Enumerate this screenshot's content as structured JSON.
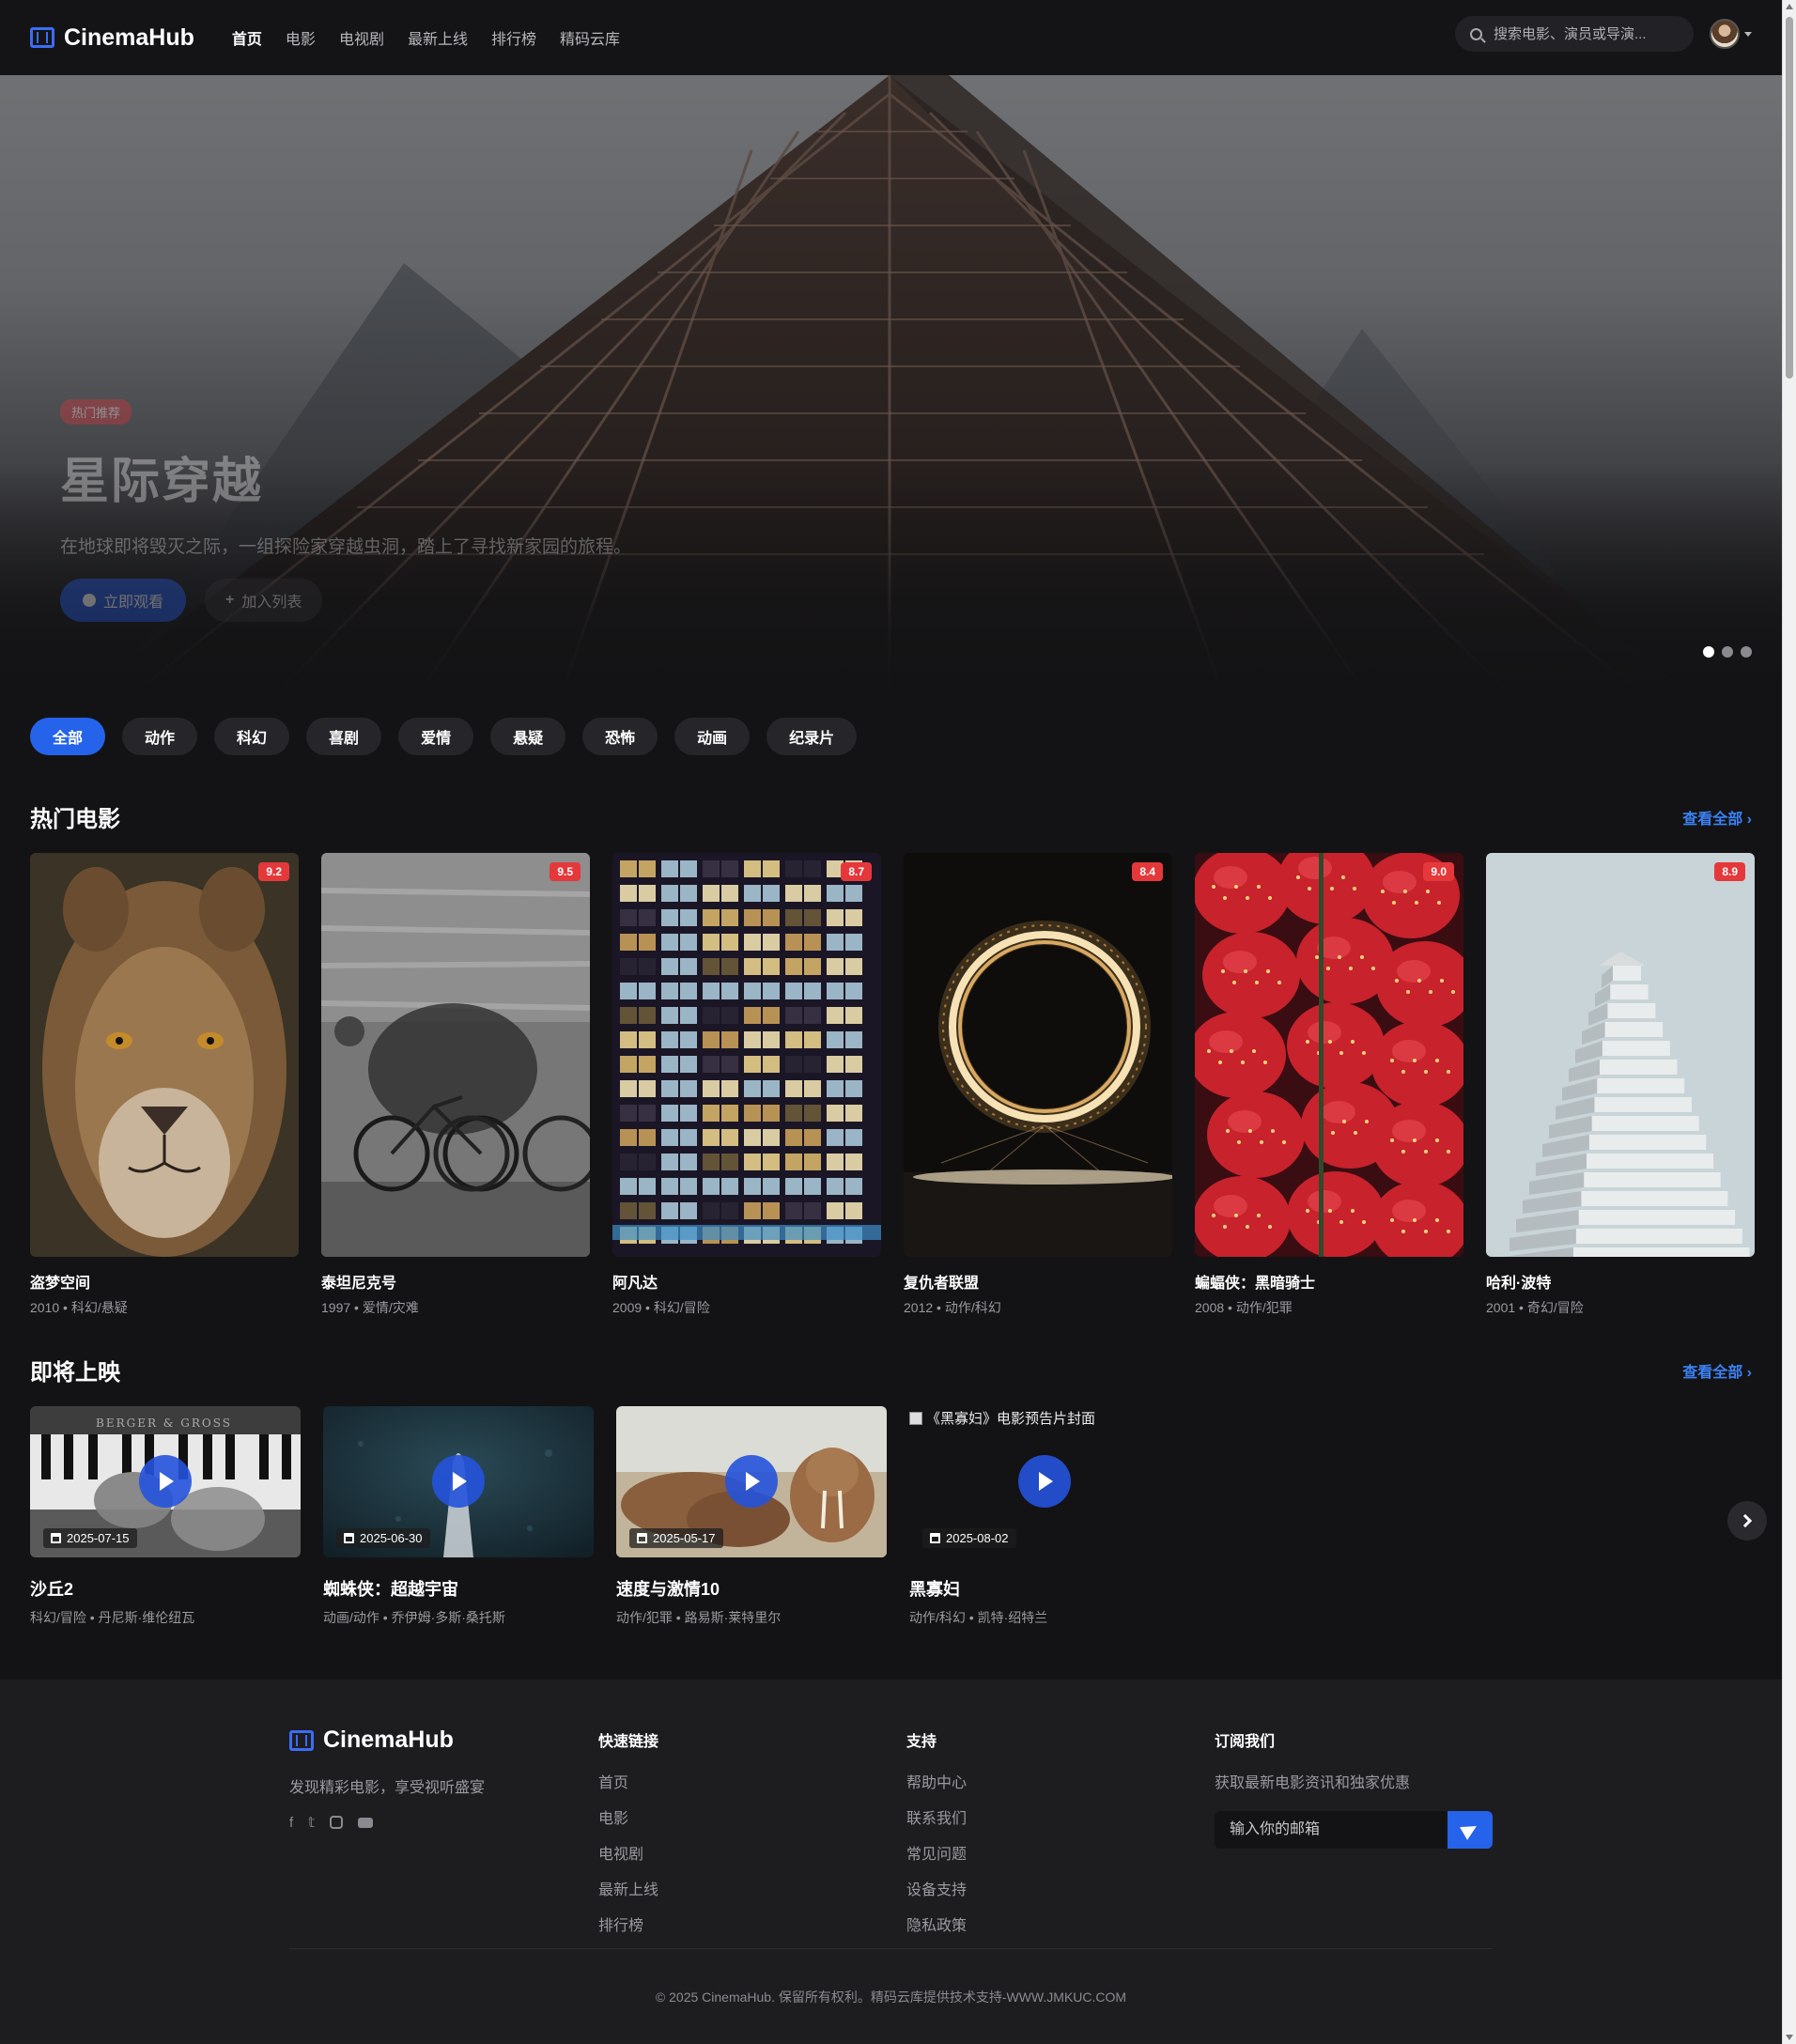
{
  "header": {
    "brand": "CinemaHub",
    "nav": [
      "首页",
      "电影",
      "电视剧",
      "最新上线",
      "排行榜",
      "精码云库"
    ],
    "active_nav": "首页",
    "search_placeholder": "搜索电影、演员或导演..."
  },
  "hero": {
    "badge": "热门推荐",
    "title": "星际穿越",
    "description": "在地球即将毁灭之际，一组探险家穿越虫洞，踏上了寻找新家园的旅程。",
    "watch_label": "立即观看",
    "list_label": "加入列表",
    "slides_total": 3,
    "active_slide": 1
  },
  "genres": {
    "items": [
      "全部",
      "动作",
      "科幻",
      "喜剧",
      "爱情",
      "悬疑",
      "恐怖",
      "动画",
      "纪录片"
    ],
    "active": "全部"
  },
  "popular": {
    "title": "热门电影",
    "view_all": "查看全部",
    "movies": [
      {
        "title": "盗梦空间",
        "year": "2010",
        "genre": "科幻/悬疑",
        "rating": "9.2",
        "meta": "2010 • 科幻/悬疑",
        "image": "lioness"
      },
      {
        "title": "泰坦尼克号",
        "year": "1997",
        "genre": "爱情/灾难",
        "rating": "9.5",
        "meta": "1997 • 爱情/灾难",
        "image": "cyclists"
      },
      {
        "title": "阿凡达",
        "year": "2009",
        "genre": "科幻/冒险",
        "rating": "8.7",
        "meta": "2009 • 科幻/冒险",
        "image": "building-windows"
      },
      {
        "title": "复仇者联盟",
        "year": "2012",
        "genre": "动作/科幻",
        "rating": "8.4",
        "meta": "2012 • 动作/科幻",
        "image": "fire-ring"
      },
      {
        "title": "蝙蝠侠：黑暗骑士",
        "year": "2008",
        "genre": "动作/犯罪",
        "rating": "9.0",
        "meta": "2008 • 动作/犯罪",
        "image": "strawberries"
      },
      {
        "title": "哈利·波特",
        "year": "2001",
        "genre": "奇幻/冒险",
        "rating": "8.9",
        "meta": "2001 • 奇幻/冒险",
        "image": "white-tower"
      }
    ]
  },
  "upcoming": {
    "title": "即将上映",
    "view_all": "查看全部",
    "movies": [
      {
        "title": "沙丘2",
        "date": "2025-07-15",
        "meta": "科幻/冒险 • 丹尼斯·维伦纽瓦",
        "image": "piano"
      },
      {
        "title": "蜘蛛侠：超越宇宙",
        "date": "2025-06-30",
        "meta": "动画/动作 • 乔伊姆·多斯·桑托斯",
        "image": "underwater"
      },
      {
        "title": "速度与激情10",
        "date": "2025-05-17",
        "meta": "动作/犯罪 • 路易斯·莱特里尔",
        "image": "walrus"
      },
      {
        "title": "黑寡妇",
        "date": "2025-08-02",
        "meta": "动作/科幻 • 凯特·绍特兰",
        "image_alt": "《黑寡妇》电影预告片封面"
      }
    ]
  },
  "footer": {
    "brand": "CinemaHub",
    "tagline": "发现精彩电影，享受视听盛宴",
    "social_icons": [
      "facebook-icon",
      "twitter-icon",
      "instagram-icon",
      "youtube-icon"
    ],
    "quick_links_title": "快速链接",
    "quick_links": [
      "首页",
      "电影",
      "电视剧",
      "最新上线",
      "排行榜"
    ],
    "support_title": "支持",
    "support_links": [
      "帮助中心",
      "联系我们",
      "常见问题",
      "设备支持",
      "隐私政策"
    ],
    "subscribe_title": "订阅我们",
    "subscribe_text": "获取最新电影资讯和独家优惠",
    "email_placeholder": "输入你的邮箱",
    "copyright": "© 2025 CinemaHub. 保留所有权利。精码云库提供技术支持-WWW.JMKUC.COM"
  },
  "colors": {
    "accent": "#2563eb",
    "rating": "#e5383b",
    "background": "#131315"
  }
}
